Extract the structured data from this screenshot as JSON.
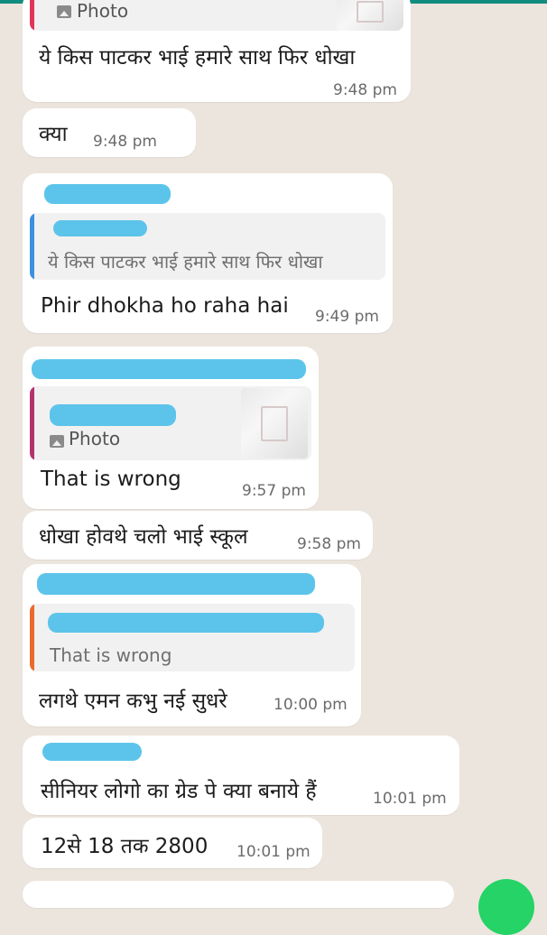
{
  "colors": {
    "background": "#ece5dd",
    "bubble": "#ffffff",
    "quote_bar_red": "#e0355a",
    "quote_bar_blue": "#3d8fe0",
    "quote_bar_purple": "#b4336f",
    "quote_bar_orange": "#ea6a2e",
    "redaction": "#5cc4ea",
    "fab": "#25d366"
  },
  "messages": [
    {
      "quote": {
        "label": "Photo"
      },
      "text": "ये किस पाटकर भाई हमारे साथ फिर धोखा",
      "time": "9:48 pm"
    },
    {
      "text": "क्या",
      "time": "9:48 pm"
    },
    {
      "quote": {
        "text": "ये किस पाटकर भाई हमारे साथ फिर धोखा"
      },
      "text": "Phir dhokha ho raha hai",
      "time": "9:49 pm"
    },
    {
      "quote": {
        "label": "Photo"
      },
      "text": "That is wrong",
      "time": "9:57 pm"
    },
    {
      "text": "धोखा होवथे चलो भाई स्कूल",
      "time": "9:58 pm"
    },
    {
      "quote": {
        "text": "That is wrong"
      },
      "text": "लगथे एमन कभु नई सुधरे",
      "time": "10:00 pm"
    },
    {
      "text": "सीनियर लोगो का ग्रेड पे क्या बनाये हैं",
      "time": "10:01 pm"
    },
    {
      "text": "12से 18 तक 2800",
      "time": "10:01 pm"
    }
  ]
}
